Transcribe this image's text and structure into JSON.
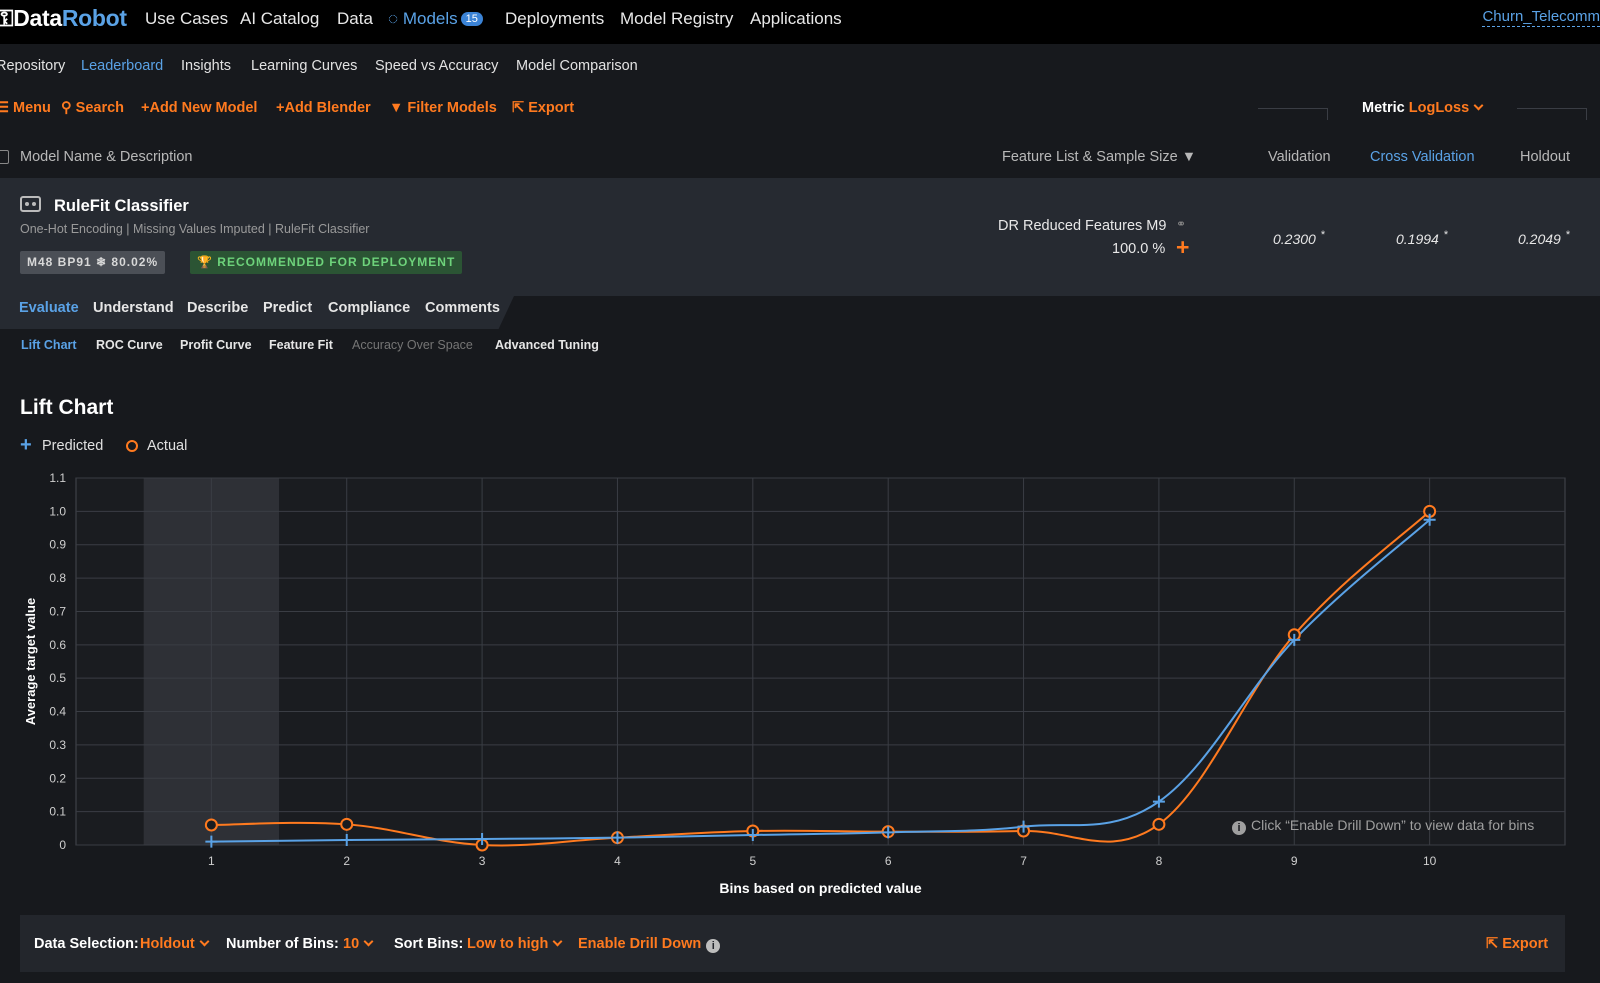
{
  "topnav": {
    "logo_a": "Data",
    "logo_b": "Robot",
    "items": [
      "Use Cases",
      "AI Catalog",
      "Data",
      "Models",
      "Deployments",
      "Model Registry",
      "Applications"
    ],
    "models_count": "15",
    "project": "Churn_Telecomm"
  },
  "subnav": {
    "items": [
      "Repository",
      "Leaderboard",
      "Insights",
      "Learning Curves",
      "Speed vs Accuracy",
      "Model Comparison"
    ]
  },
  "toolbar": {
    "menu": "Menu",
    "search": "Search",
    "add_model": "Add New Model",
    "add_blender": "Add Blender",
    "filter": "Filter Models",
    "export": "Export",
    "metric_label": "Metric",
    "metric_value": "LogLoss"
  },
  "columns": {
    "name": "Model Name & Description",
    "feature": "Feature List & Sample Size",
    "validation": "Validation",
    "cross_validation": "Cross Validation",
    "holdout": "Holdout"
  },
  "model": {
    "name": "RuleFit Classifier",
    "description": "One-Hot Encoding | Missing Values Imputed | RuleFit Classifier",
    "tag_ids": "M48  BP91  ❄ 80.02%",
    "tag_recommended": "RECOMMENDED FOR DEPLOYMENT",
    "feature_list": "DR Reduced Features M9",
    "sample_size": "100.0 %",
    "validation": "0.2300",
    "cross_validation": "0.1994",
    "holdout": "0.2049",
    "star": "*"
  },
  "tabs": [
    "Evaluate",
    "Understand",
    "Describe",
    "Predict",
    "Compliance",
    "Comments"
  ],
  "subtabs": [
    "Lift Chart",
    "ROC Curve",
    "Profit Curve",
    "Feature Fit",
    "Accuracy Over Space",
    "Advanced Tuning"
  ],
  "lift": {
    "title": "Lift Chart",
    "legend_predicted": "Predicted",
    "legend_actual": "Actual",
    "drill_hint": "Click “Enable Drill Down” to view data for bins"
  },
  "chart_data": {
    "type": "line",
    "x": [
      1,
      2,
      3,
      4,
      5,
      6,
      7,
      8,
      9,
      10
    ],
    "series": [
      {
        "name": "Predicted",
        "values": [
          0.01,
          0.015,
          0.018,
          0.022,
          0.03,
          0.038,
          0.055,
          0.13,
          0.615,
          0.975
        ]
      },
      {
        "name": "Actual",
        "values": [
          0.06,
          0.062,
          0.0,
          0.022,
          0.042,
          0.04,
          0.042,
          0.062,
          0.63,
          1.0
        ]
      }
    ],
    "xlabel": "Bins based on predicted value",
    "ylabel": "Average target value",
    "xlim": [
      0,
      11
    ],
    "ylim": [
      0,
      1.1
    ],
    "yticks": [
      "0",
      "0.1",
      "0.2",
      "0.3",
      "0.4",
      "0.5",
      "0.6",
      "0.7",
      "0.8",
      "0.9",
      "1.0",
      "1.1"
    ],
    "highlight_bin": 1,
    "grid": true,
    "colors": {
      "predicted": "#5aa2e6",
      "actual": "#ff7a1f"
    }
  },
  "bottom": {
    "data_selection_label": "Data Selection:",
    "data_selection": "Holdout",
    "bins_label": "Number of Bins:",
    "bins": "10",
    "sort_label": "Sort Bins:",
    "sort": "Low to high",
    "drill": "Enable Drill Down",
    "export": "Export"
  }
}
